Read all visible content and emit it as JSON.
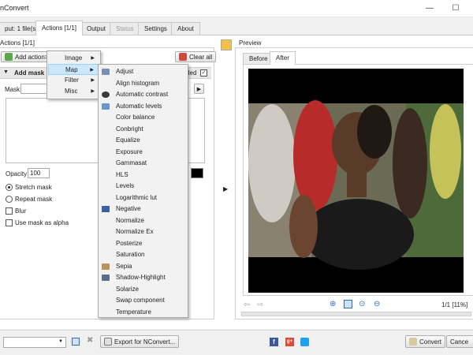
{
  "window": {
    "title": "nConvert",
    "minimize": "—",
    "maximize": "☐"
  },
  "tabs": [
    {
      "label": "put: 1 file(s)"
    },
    {
      "label": "Actions [1/1]",
      "active": true
    },
    {
      "label": "Output"
    },
    {
      "label": "Status",
      "disabled": true
    },
    {
      "label": "Settings"
    },
    {
      "label": "About"
    }
  ],
  "actions_panel": {
    "header": "Actions [1/1]",
    "add_action_label": "Add action>",
    "clear_all_label": "Clear all",
    "section_title": "Add mask",
    "section_right_label": "iled",
    "mask_label": "Mask",
    "opacity_label": "Opacity",
    "opacity_value": "100",
    "stretch_mask": "Stretch mask",
    "repeat_mask": "Repeat mask",
    "blur": "Blur",
    "use_mask_as_alpha": "Use mask as alpha"
  },
  "add_action_menu": {
    "items": [
      {
        "label": "Image",
        "has_submenu": true
      },
      {
        "label": "Map",
        "has_submenu": true,
        "selected": true
      },
      {
        "label": "Filter",
        "has_submenu": true
      },
      {
        "label": "Misc",
        "has_submenu": true
      }
    ]
  },
  "map_submenu": {
    "items": [
      {
        "label": "Adjust",
        "icon": "adjust-icon"
      },
      {
        "label": "Align histogram"
      },
      {
        "label": "Automatic contrast",
        "icon": "contrast-icon"
      },
      {
        "label": "Automatic levels",
        "icon": "levels-icon"
      },
      {
        "label": "Color balance"
      },
      {
        "label": "Conbright"
      },
      {
        "label": "Equalize"
      },
      {
        "label": "Exposure"
      },
      {
        "label": "Gammasat"
      },
      {
        "label": "HLS"
      },
      {
        "label": "Levels"
      },
      {
        "label": "Logarithmic lut"
      },
      {
        "label": "Negative",
        "icon": "negative-icon"
      },
      {
        "label": "Normalize"
      },
      {
        "label": "Normalize Ex"
      },
      {
        "label": "Posterize"
      },
      {
        "label": "Saturation"
      },
      {
        "label": "Sepia",
        "icon": "sepia-icon"
      },
      {
        "label": "Shadow-Highlight",
        "icon": "shadow-highlight-icon"
      },
      {
        "label": "Solarize"
      },
      {
        "label": "Swap component"
      },
      {
        "label": "Temperature"
      }
    ]
  },
  "preview": {
    "label": "Preview",
    "tabs": [
      {
        "label": "Before"
      },
      {
        "label": "After",
        "active": true
      }
    ],
    "page_info": "1/1 [11%]"
  },
  "bottom": {
    "export_label": "Export for NConvert...",
    "convert_label": "Convert",
    "cancel_label": "Cance"
  },
  "colors": {
    "selection": "#cce8ff",
    "accent_blue": "#2f6fb6",
    "facebook": "#3b5998",
    "googleplus": "#dd4b39",
    "twitter": "#1da1f2"
  }
}
